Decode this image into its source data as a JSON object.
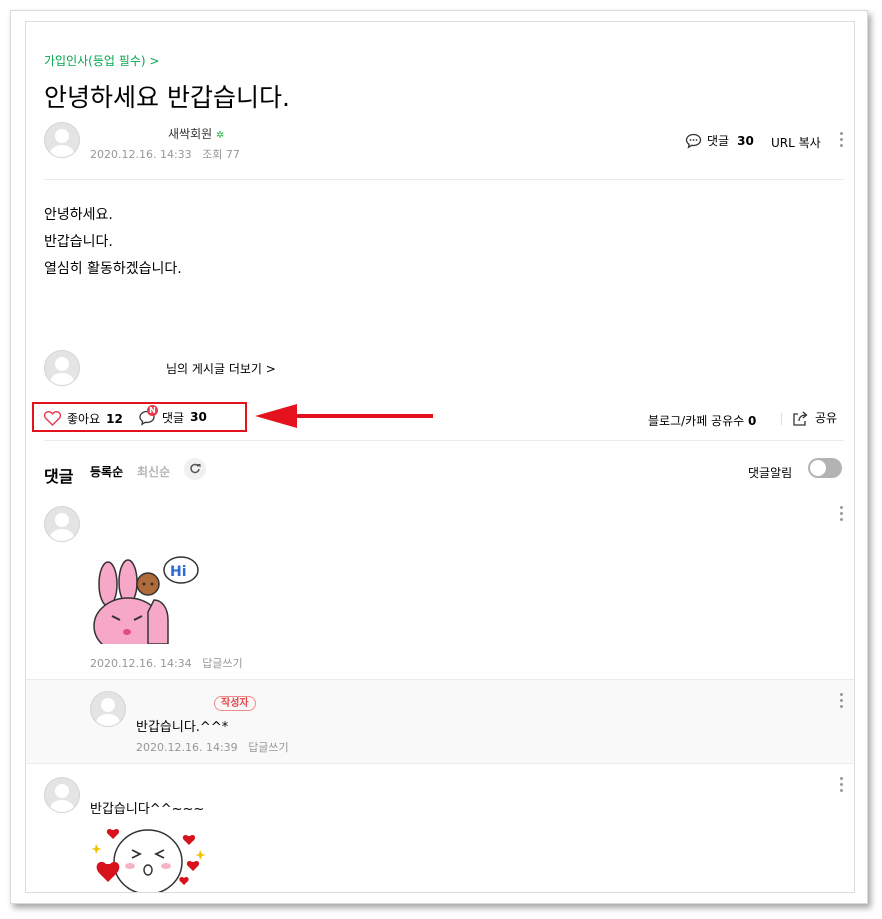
{
  "post": {
    "category": "가입인사(등업 필수) >",
    "title": "안녕하세요 반갑습니다.",
    "author_grade": "새싹회원",
    "date": "2020.12.16. 14:33",
    "views": "조회 77",
    "comment_label": "댓글",
    "comment_count": "30",
    "url_copy": "URL 복사",
    "body_lines": [
      "안녕하세요.",
      "반갑습니다.",
      "열심히 활동하겠습니다."
    ],
    "more_posts": "님의 게시글 더보기 >"
  },
  "actions": {
    "like_label": "좋아요",
    "like_count": "12",
    "comment_label": "댓글",
    "comment_count": "30",
    "comment_badge": "N",
    "share_count_label": "블로그/카페 공유수",
    "share_count": "0",
    "share_label": "공유",
    "highlight_color": "#e3121c"
  },
  "comments_header": {
    "title": "댓글",
    "sort_registered": "등록순",
    "sort_latest": "최신순",
    "notify_label": "댓글알림"
  },
  "comments": [
    {
      "text": "",
      "sticker": "bunny-hi-sticker",
      "sticker_text": "Hi",
      "date": "2020.12.16. 14:34",
      "reply_label": "답글쓰기"
    },
    {
      "badge": "작성자",
      "text": "반갑습니다.^^*",
      "date": "2020.12.16. 14:39",
      "reply_label": "답글쓰기"
    },
    {
      "text": "반갑습니다^^~~~",
      "sticker": "hearts-kiss-sticker"
    }
  ]
}
